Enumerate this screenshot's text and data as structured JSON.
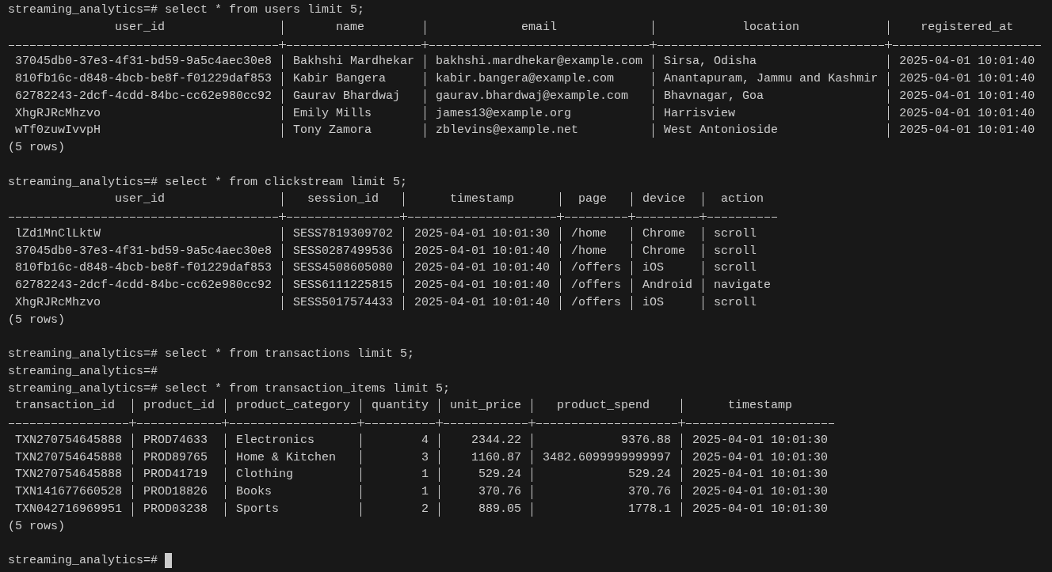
{
  "terminal": {
    "blocks": [
      {
        "prompt": "streaming_analytics=#",
        "command": "select * from users limit 5;",
        "table": {
          "columns": [
            {
              "name": "user_id"
            },
            {
              "name": "name"
            },
            {
              "name": "email"
            },
            {
              "name": "location"
            },
            {
              "name": "registered_at"
            }
          ],
          "rows": [
            [
              "37045db0-37e3-4f31-bd59-9a5c4aec30e8",
              "Bakhshi Mardhekar",
              "bakhshi.mardhekar@example.com",
              "Sirsa, Odisha",
              "2025-04-01 10:01:40"
            ],
            [
              "810fb16c-d848-4bcb-be8f-f01229daf853",
              "Kabir Bangera",
              "kabir.bangera@example.com",
              "Anantapuram, Jammu and Kashmir",
              "2025-04-01 10:01:40"
            ],
            [
              "62782243-2dcf-4cdd-84bc-cc62e980cc92",
              "Gaurav Bhardwaj",
              "gaurav.bhardwaj@example.com",
              "Bhavnagar, Goa",
              "2025-04-01 10:01:40"
            ],
            [
              "XhgRJRcMhzvo",
              "Emily Mills",
              "james13@example.org",
              "Harrisview",
              "2025-04-01 10:01:40"
            ],
            [
              "wTf0zuwIvvpH",
              "Tony Zamora",
              "zblevins@example.net",
              "West Antonioside",
              "2025-04-01 10:01:40"
            ]
          ],
          "footer": "(5 rows)"
        }
      },
      {
        "prompt": "streaming_analytics=#",
        "command": "select * from clickstream limit 5;",
        "table": {
          "columns": [
            {
              "name": "user_id"
            },
            {
              "name": "session_id"
            },
            {
              "name": "timestamp"
            },
            {
              "name": "page"
            },
            {
              "name": "device"
            },
            {
              "name": "action"
            }
          ],
          "rows": [
            [
              "lZd1MnClLktW",
              "SESS7819309702",
              "2025-04-01 10:01:30",
              "/home",
              "Chrome",
              "scroll"
            ],
            [
              "37045db0-37e3-4f31-bd59-9a5c4aec30e8",
              "SESS0287499536",
              "2025-04-01 10:01:40",
              "/home",
              "Chrome",
              "scroll"
            ],
            [
              "810fb16c-d848-4bcb-be8f-f01229daf853",
              "SESS4508605080",
              "2025-04-01 10:01:40",
              "/offers",
              "iOS",
              "scroll"
            ],
            [
              "62782243-2dcf-4cdd-84bc-cc62e980cc92",
              "SESS6111225815",
              "2025-04-01 10:01:40",
              "/offers",
              "Android",
              "navigate"
            ],
            [
              "XhgRJRcMhzvo",
              "SESS5017574433",
              "2025-04-01 10:01:40",
              "/offers",
              "iOS",
              "scroll"
            ]
          ],
          "footer": "(5 rows)"
        }
      },
      {
        "prompt": "streaming_analytics=#",
        "command": "select * from transactions limit 5;"
      },
      {
        "prompt": "streaming_analytics=#"
      },
      {
        "prompt": "streaming_analytics=#",
        "command": "select * from transaction_items limit 5;",
        "table": {
          "columns": [
            {
              "name": "transaction_id"
            },
            {
              "name": "product_id"
            },
            {
              "name": "product_category"
            },
            {
              "name": "quantity",
              "right_aligned": true
            },
            {
              "name": "unit_price",
              "right_aligned": true
            },
            {
              "name": "product_spend",
              "right_aligned": true
            },
            {
              "name": "timestamp"
            }
          ],
          "rows": [
            [
              "TXN270754645888",
              "PROD74633",
              "Electronics",
              "4",
              "2344.22",
              "9376.88",
              "2025-04-01 10:01:30"
            ],
            [
              "TXN270754645888",
              "PROD89765",
              "Home & Kitchen",
              "3",
              "1160.87",
              "3482.6099999999997",
              "2025-04-01 10:01:30"
            ],
            [
              "TXN270754645888",
              "PROD41719",
              "Clothing",
              "1",
              "529.24",
              "529.24",
              "2025-04-01 10:01:30"
            ],
            [
              "TXN141677660528",
              "PROD18826",
              "Books",
              "1",
              "370.76",
              "370.76",
              "2025-04-01 10:01:30"
            ],
            [
              "TXN042716969951",
              "PROD03238",
              "Sports",
              "2",
              "889.05",
              "1778.1",
              "2025-04-01 10:01:30"
            ]
          ],
          "footer": "(5 rows)"
        }
      },
      {
        "prompt": "streaming_analytics=#",
        "cursor": true
      }
    ]
  }
}
